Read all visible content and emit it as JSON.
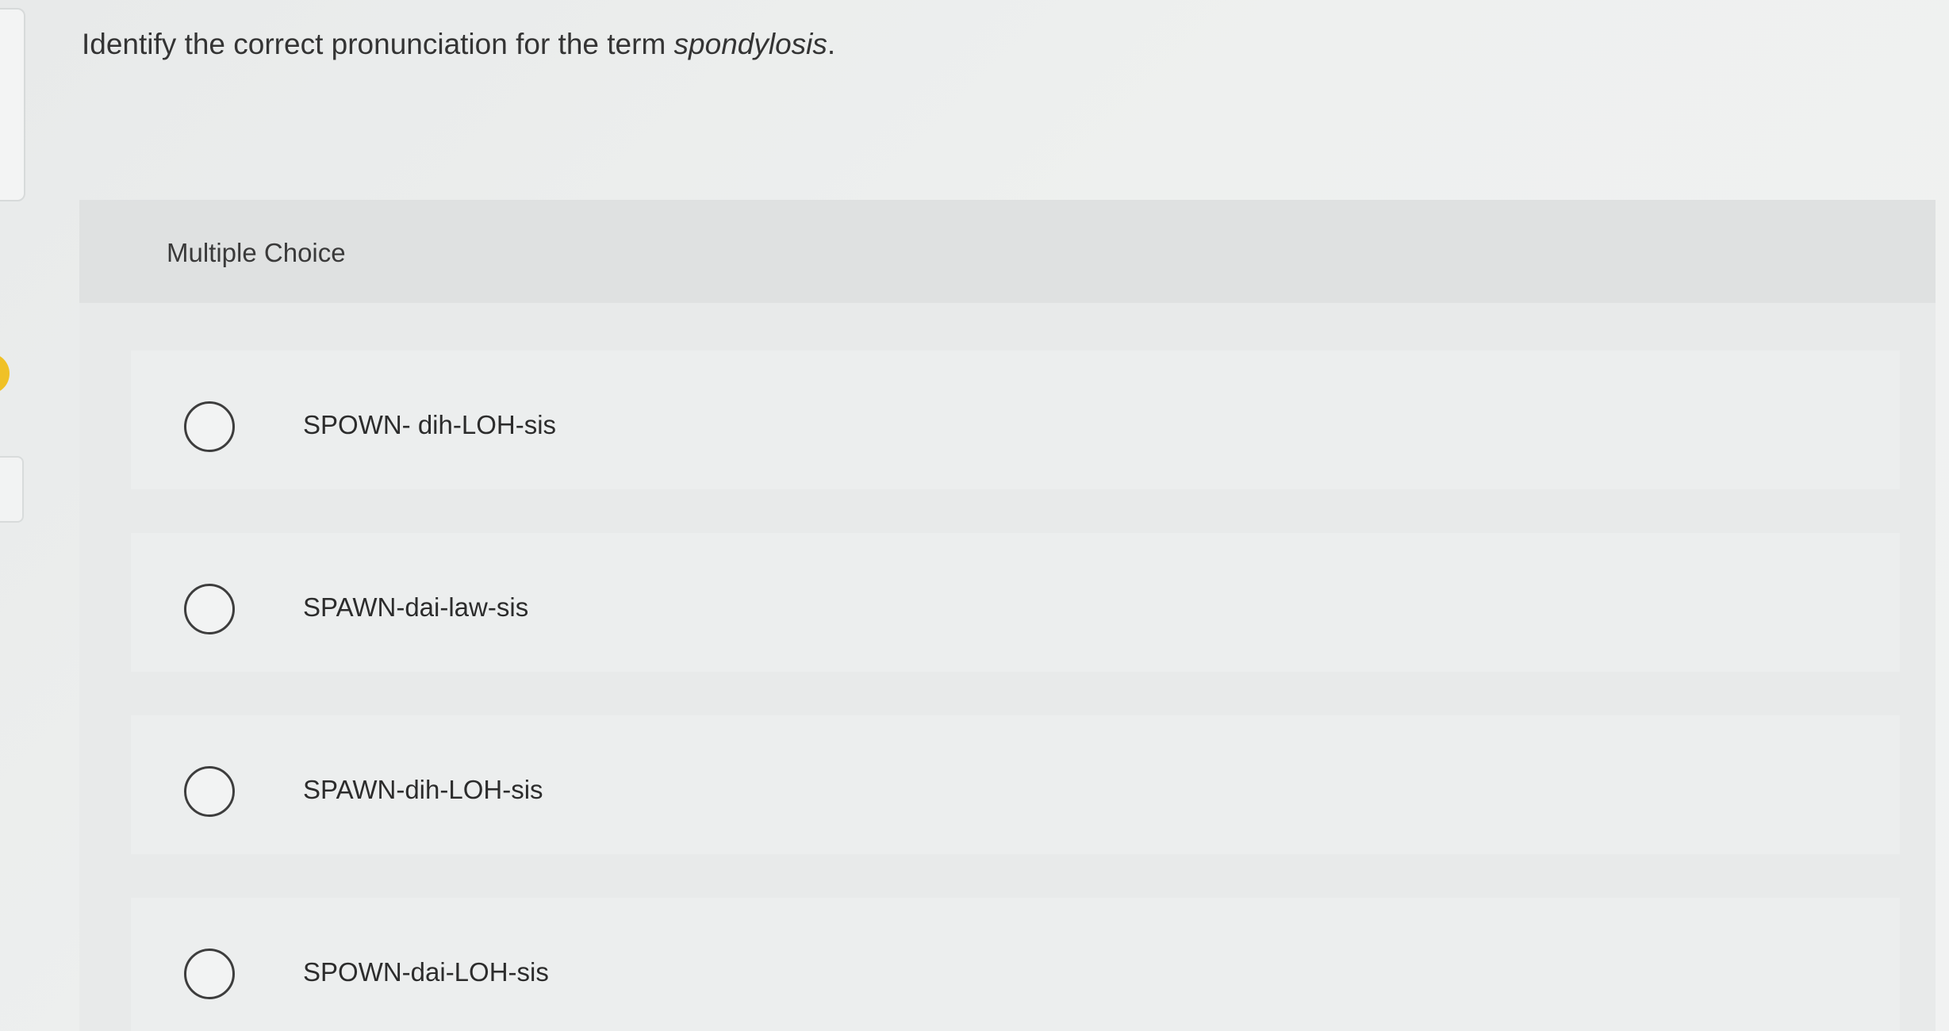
{
  "question": {
    "prefix": "Identify the correct pronunciation for the term ",
    "term": "spondylosis",
    "suffix": "."
  },
  "multiple_choice": {
    "label": "Multiple Choice",
    "options": [
      {
        "label": "SPOWN- dih-LOH-sis",
        "selected": false
      },
      {
        "label": "SPAWN-dai-law-sis",
        "selected": false
      },
      {
        "label": "SPAWN-dih-LOH-sis",
        "selected": false
      },
      {
        "label": "SPOWN-dai-LOH-sis",
        "selected": false
      }
    ]
  },
  "colors": {
    "accent_marker": "#f0c126",
    "background": "#eef0ef",
    "card": "#e8eaea",
    "text": "#2f2f2f"
  }
}
